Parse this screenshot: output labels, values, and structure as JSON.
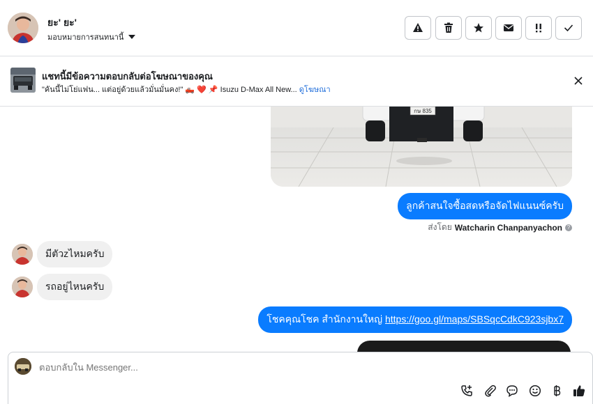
{
  "header": {
    "user_name": "ยะ' ยะ'",
    "assign_label": "มอบหมายการสนทนานี้",
    "actions": [
      {
        "name": "report-button",
        "icon": "warning-icon"
      },
      {
        "name": "delete-button",
        "icon": "trash-icon"
      },
      {
        "name": "star-button",
        "icon": "star-icon"
      },
      {
        "name": "mark-unread-button",
        "icon": "envelope-icon"
      },
      {
        "name": "follow-up-button",
        "icon": "double-exclamation-icon"
      },
      {
        "name": "done-button",
        "icon": "check-icon"
      }
    ]
  },
  "ad_banner": {
    "title": "แชทนี้มีข้อความตอบกลับต่อโฆษณาของคุณ",
    "subtitle": "\"คันนี้ไม่โย่แฟน... แต่อยู่ด้วยแล้วมั่นมั่นคง!\" 🛻 ❤️ 📌 Isuzu D-Max All New...",
    "link_label": "ดูโฆษณา",
    "plate_text": "กษ 835"
  },
  "messages": {
    "out_1": "ลูกค้าสนใจซื้อสดหรือจัดไฟแนนซ์ครับ",
    "sent_by_prefix": "ส่งโดย",
    "sent_by_name": "Watcharin Chanpanyachon",
    "sent_by_help": "?",
    "in_1": "มีตัวzไหมครับ",
    "in_2": "รถอยู่ไหนครับ",
    "out_2_text": "โชคคุณโชค สำนักงานใหญ่ ",
    "out_2_link": "https://goo.gl/maps/SBSqcCdkC923sjbx7"
  },
  "composer": {
    "placeholder": "ตอบกลับใน Messenger...",
    "icons": [
      "phone-add-icon",
      "paperclip-icon",
      "chat-bubble-icon",
      "smiley-icon",
      "baht-icon",
      "thumbs-up-icon"
    ]
  },
  "colors": {
    "accent": "#0a7cff",
    "incoming_bubble": "#f0f0f0",
    "link": "#216fdb"
  }
}
